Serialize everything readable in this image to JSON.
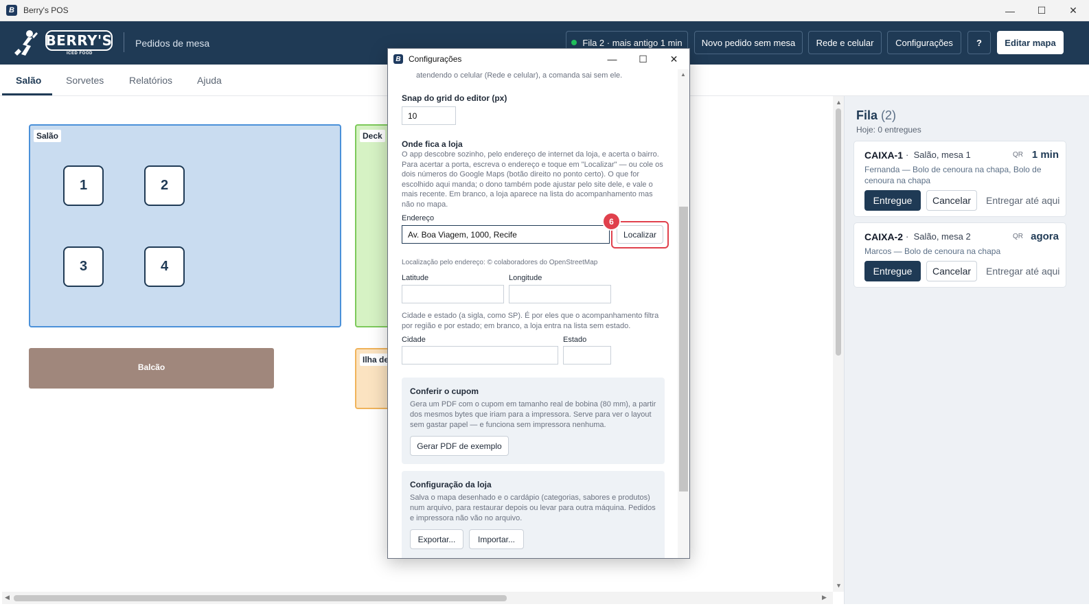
{
  "window": {
    "title": "Berry's POS",
    "controls": [
      "—",
      "☐",
      "✕"
    ]
  },
  "header": {
    "logo_text": "BERRY'S",
    "logo_sub": "ICED FOOD",
    "subtitle": "Pedidos de mesa",
    "status": "Fila 2 · mais antigo 1 min",
    "buttons": {
      "new_order": "Novo pedido sem mesa",
      "network": "Rede e celular",
      "settings": "Configurações",
      "help": "?",
      "edit_map": "Editar mapa"
    },
    "colors": {
      "bar": "#1f3a55",
      "status_dot": "#22c55e"
    }
  },
  "tabs": [
    "Salão",
    "Sorvetes",
    "Relatórios",
    "Ajuda"
  ],
  "floor": {
    "zones": {
      "salao": "Salão",
      "deck": "Deck",
      "balcao": "Balcão",
      "ilha": "Ilha de"
    },
    "tables": [
      "1",
      "2",
      "3",
      "4"
    ]
  },
  "queue": {
    "title": "Fila",
    "count": "(2)",
    "today": "Hoje: 0 entregues",
    "cards": [
      {
        "id": "CAIXA-1",
        "where": "Salão, mesa 1",
        "qr": "QR",
        "time": "1 min",
        "desc": "Fernanda  —  Bolo de cenoura na chapa, Bolo de cenoura na chapa"
      },
      {
        "id": "CAIXA-2",
        "where": "Salão, mesa 2",
        "qr": "QR",
        "time": "agora",
        "desc": "Marcos  —  Bolo de cenoura na chapa"
      }
    ],
    "actions": {
      "deliver": "Entregue",
      "cancel": "Cancelar",
      "deliver_upto": "Entregar até aqui"
    },
    "separator": "·"
  },
  "dialog": {
    "title": "Configurações",
    "top_text": "atendendo o celular (Rede e celular), a comanda sai sem ele.",
    "snap_label": "Snap do grid do editor (px)",
    "snap_value": "10",
    "location_title": "Onde fica a loja",
    "location_help": "O app descobre sozinho, pelo endereço de internet da loja, e acerta o bairro. Para acertar a porta, escreva o endereço e toque em \"Localizar\" — ou cole os dois números do Google Maps (botão direito no ponto certo). O que for escolhido aqui manda; o dono também pode ajustar pelo site dele, e vale o mais recente. Em branco, a loja aparece na lista do acompanhamento mas não no mapa.",
    "address_label": "Endereço",
    "address_value": "Av. Boa Viagem, 1000, Recife",
    "locate_button": "Localizar",
    "osm_credit": "Localização pelo endereço: © colaboradores do OpenStreetMap",
    "lat_label": "Latitude",
    "lng_label": "Longitude",
    "city_help": "Cidade e estado (a sigla, como SP). É por eles que o acompanhamento filtra por região e por estado; em branco, a loja entra na lista sem estado.",
    "city_label": "Cidade",
    "state_label": "Estado",
    "coupon": {
      "title": "Conferir o cupom",
      "text": "Gera um PDF com o cupom em tamanho real de bobina (80 mm), a partir dos mesmos bytes que iriam para a impressora. Serve para ver o layout sem gastar papel — e funciona sem impressora nenhuma.",
      "button": "Gerar PDF de exemplo"
    },
    "store_config": {
      "title": "Configuração da loja",
      "text": "Salva o mapa desenhado e o cardápio (categorias, sabores e produtos) num arquivo, para restaurar depois ou levar para outra máquina. Pedidos e impressora não vão no arquivo.",
      "export": "Exportar...",
      "import": "Importar..."
    }
  },
  "step_badge": "6"
}
